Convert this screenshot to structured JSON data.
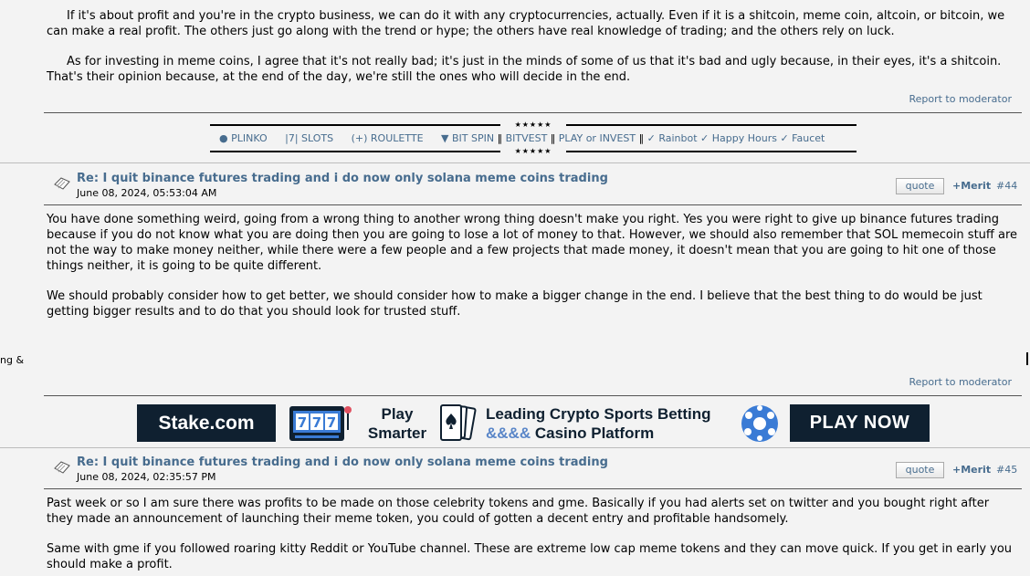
{
  "post43": {
    "paragraphs": [
      "If it's about profit and you're in the crypto business, we can do it with any cryptocurrencies, actually. Even if it is a shitcoin, meme coin, altcoin, or bitcoin, we can make a real profit. The others just go along with the trend or hype; the others have real knowledge of trading; and the others rely on luck.",
      "As for investing in meme coins, I agree that it's not really bad; it's just in the minds of some of us that it's bad and ugly because, in their eyes, it's a shitcoin. That's their opinion because, at the end of the day, we're still the ones who will decide in the end."
    ],
    "report": "Report to moderator"
  },
  "signature": {
    "stars": "★★★★★",
    "items": [
      "● PLINKO",
      "|7| SLOTS",
      "(+) ROULETTE",
      "▼ BIT SPIN",
      "‖",
      "BITVEST",
      "‖",
      "PLAY or INVEST",
      "‖",
      "✓ Rainbot",
      "✓ Happy Hours",
      "✓ Faucet"
    ]
  },
  "post44": {
    "subject": "Re: I quit binance futures trading and i do now only solana meme coins trading",
    "date": "June 08, 2024, 05:53:04 AM",
    "quote": "quote",
    "merit": "+Merit",
    "number": "#44",
    "paragraphs": [
      "You have done something weird, going from a wrong thing to another wrong thing doesn't make you right. Yes you were right to give up binance futures trading because if you do not know what you are doing then you are going to lose a lot of money to that. However, we should also remember that SOL memecoin stuff are not the way to make money neither, while there were a few people and a few projects that made money, it doesn't mean that you are going to hit one of those things neither, it is going to be quite different.",
      "We should probably consider how to get better, we should consider how to make a bigger change in the end. I believe that the best thing to do would be just getting bigger results and to do that you should look for trusted stuff."
    ],
    "report": "Report to moderator",
    "edge_text": "ng &"
  },
  "banner": {
    "brand": "Stake.com",
    "slot_digits": "777",
    "play_smarter": [
      "Play",
      "Smarter"
    ],
    "leading_line1": "Leading Crypto Sports Betting",
    "leading_amps": "&&&&",
    "leading_line2": "Casino Platform",
    "cta": "PLAY NOW"
  },
  "post45": {
    "subject": "Re: I quit binance futures trading and i do now only solana meme coins trading",
    "date": "June 08, 2024, 02:35:57 PM",
    "quote": "quote",
    "merit": "+Merit",
    "number": "#45",
    "paragraphs": [
      "Past week or so I am sure there was profits to be made on those celebrity tokens and gme. Basically if you had alerts set on twitter and you bought right after they made an announcement of launching their meme token, you could of gotten a decent entry and profitable handsomely.",
      "Same with gme if you followed roaring kitty Reddit or YouTube channel. These are extreme low cap meme tokens and they can move quick. If you get in early you should make a profit."
    ]
  },
  "colors": {
    "link": "#476c8e",
    "banner_dark": "#0f2030",
    "background": "#f3f3f3"
  }
}
